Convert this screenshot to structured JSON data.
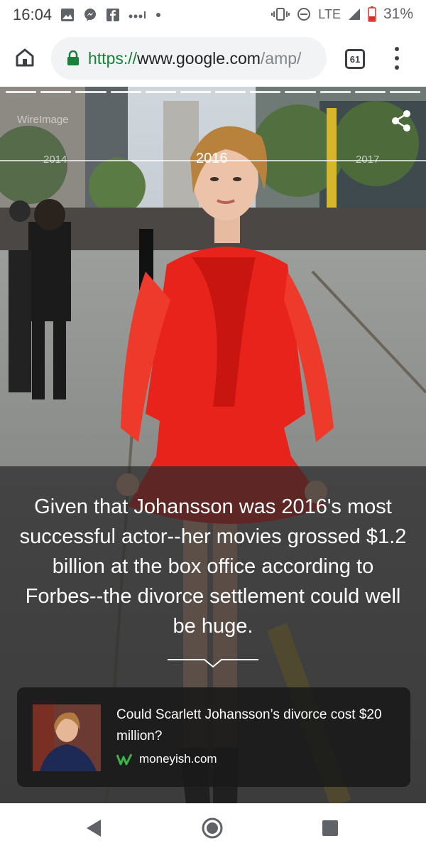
{
  "status_bar": {
    "time": "16:04",
    "network": "LTE",
    "battery": "31%",
    "left_icons": [
      "image-icon",
      "messenger-icon",
      "facebook-icon",
      "signal-dots-icon",
      "dot-icon"
    ],
    "right_icons": [
      "vibrate-icon",
      "do-not-disturb-icon",
      "signal-icon",
      "battery-icon"
    ]
  },
  "browser": {
    "url_scheme": "https://",
    "url_host": "www.google.com",
    "url_path": "/amp/",
    "tab_count": "61",
    "icons": {
      "home": "home-icon",
      "lock": "lock-icon",
      "menu": "more-vert-icon"
    }
  },
  "story": {
    "progress_segments": 12,
    "credit": "WireImage",
    "timeline": {
      "years": [
        "2014",
        "2016",
        "2017"
      ],
      "active_index": 1
    },
    "caption": "Given that Johansson was 2016's most successful actor--her movies grossed $1.2 billion at the box office according to Forbes--the divorce settlement could well be huge.",
    "card": {
      "title": "Could Scarlett Johansson’s divorce cost $20 million?",
      "source": "moneyish.com"
    }
  },
  "colors": {
    "url_scheme_green": "#188038",
    "dress_red": "#e8231c",
    "caption_panel": "#282828"
  }
}
